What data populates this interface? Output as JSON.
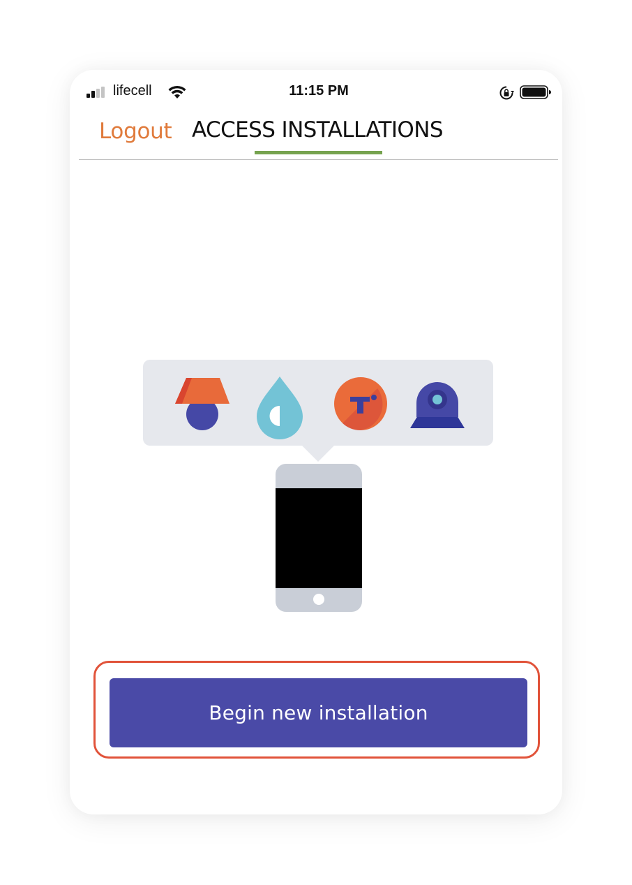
{
  "status_bar": {
    "carrier": "lifecell",
    "time": "11:15 PM",
    "icons": [
      "signal-icon",
      "wifi-icon",
      "rotation-lock-icon",
      "battery-icon"
    ]
  },
  "nav": {
    "logout_label": "Logout",
    "title": "ACCESS INSTALLATIONS"
  },
  "illustration": {
    "device_icons": [
      "lamp-icon",
      "water-drop-icon",
      "thermostat-icon",
      "camera-icon"
    ]
  },
  "actions": {
    "begin_label": "Begin new installation"
  },
  "colors": {
    "accent_orange": "#e07b3c",
    "tab_underline": "#76a34f",
    "button": "#4a4aa7",
    "highlight": "#e1533a"
  }
}
